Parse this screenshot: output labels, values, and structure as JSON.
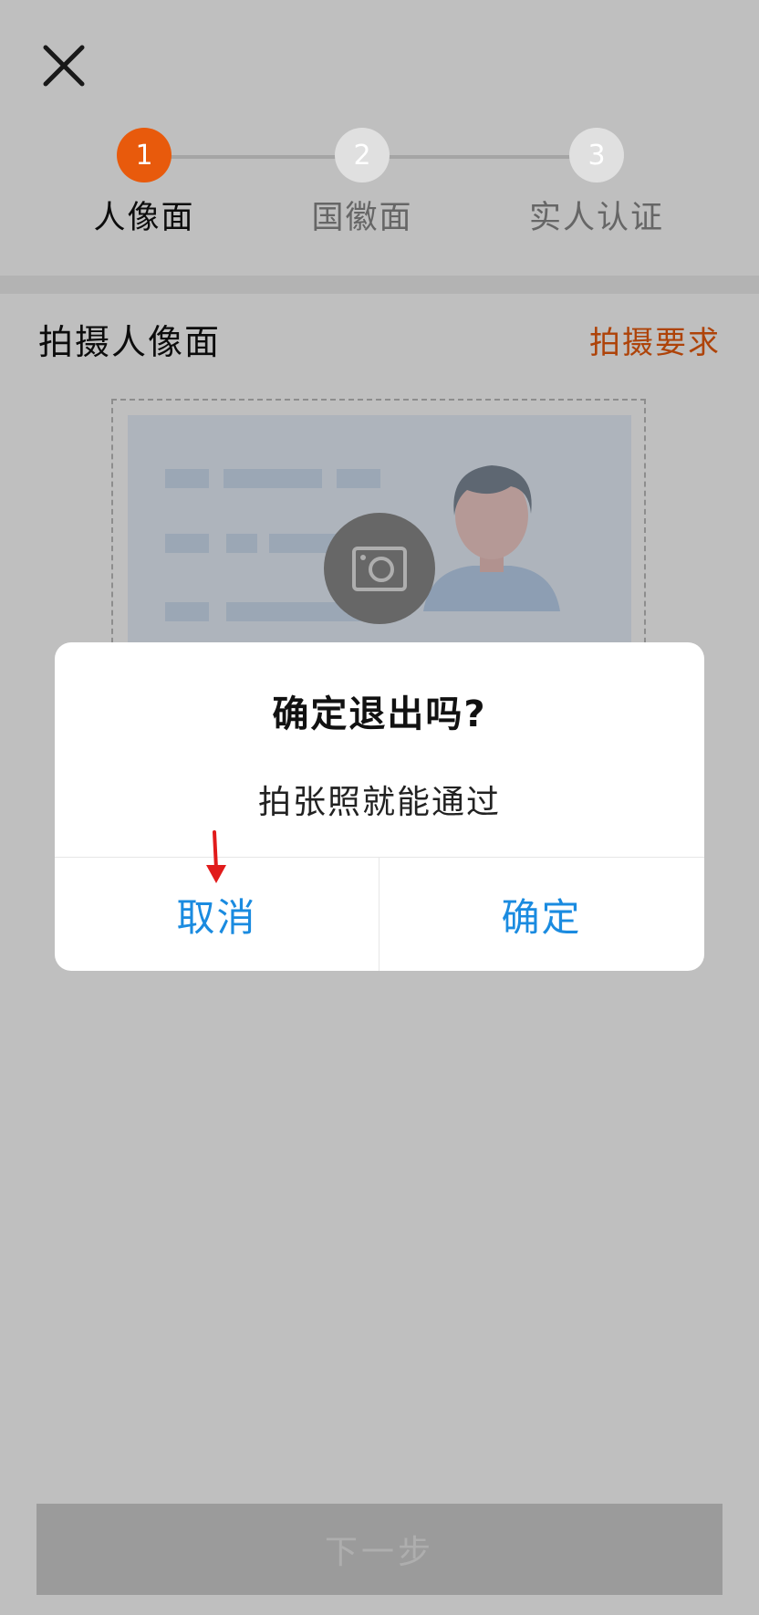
{
  "header": {
    "close_icon": "close-icon"
  },
  "stepper": {
    "steps": [
      {
        "number": "1",
        "label": "人像面",
        "state": "active"
      },
      {
        "number": "2",
        "label": "国徽面",
        "state": "inactive"
      },
      {
        "number": "3",
        "label": "实人认证",
        "state": "inactive"
      }
    ]
  },
  "section": {
    "title": "拍摄人像面",
    "requirements_link": "拍摄要求"
  },
  "capture": {
    "camera_icon": "camera-icon"
  },
  "footer": {
    "next_label": "下一步"
  },
  "dialog": {
    "title": "确定退出吗?",
    "message": "拍张照就能通过",
    "cancel_label": "取消",
    "confirm_label": "确定"
  },
  "colors": {
    "accent": "#e85a0c",
    "link_blue": "#1a8be0",
    "annotation_red": "#e11b1b"
  }
}
